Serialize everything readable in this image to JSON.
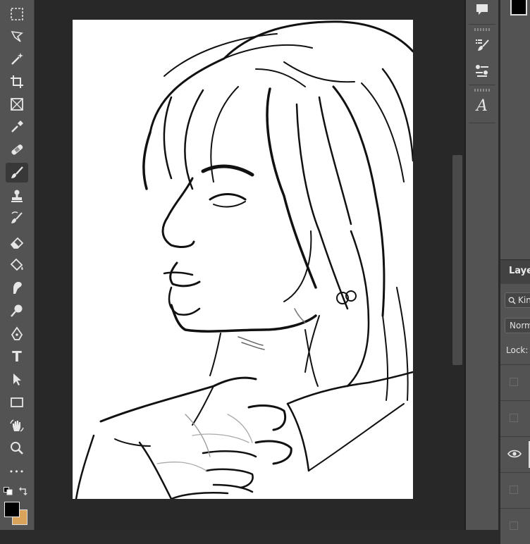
{
  "toolbar": {
    "tools": [
      {
        "name": "rectangular-marquee",
        "icon": "marquee-icon",
        "active": false
      },
      {
        "name": "lasso",
        "icon": "lasso-icon",
        "active": false
      },
      {
        "name": "magic-wand",
        "icon": "magic-wand-icon",
        "active": false
      },
      {
        "name": "crop",
        "icon": "crop-icon",
        "active": false
      },
      {
        "name": "frame",
        "icon": "frame-icon",
        "active": false
      },
      {
        "name": "eyedropper",
        "icon": "eyedropper-icon",
        "active": false
      },
      {
        "name": "healing-brush",
        "icon": "bandage-icon",
        "active": false
      },
      {
        "name": "brush",
        "icon": "brush-icon",
        "active": true
      },
      {
        "name": "clone-stamp",
        "icon": "stamp-icon",
        "active": false
      },
      {
        "name": "history-brush",
        "icon": "history-brush-icon",
        "active": false
      },
      {
        "name": "eraser",
        "icon": "eraser-icon",
        "active": false
      },
      {
        "name": "paint-bucket",
        "icon": "bucket-icon",
        "active": false
      },
      {
        "name": "smudge",
        "icon": "smudge-icon",
        "active": false
      },
      {
        "name": "dodge",
        "icon": "dodge-icon",
        "active": false
      },
      {
        "name": "pen",
        "icon": "pen-icon",
        "active": false
      },
      {
        "name": "type",
        "icon": "type-icon",
        "active": false
      },
      {
        "name": "path-selection",
        "icon": "arrow-icon",
        "active": false
      },
      {
        "name": "rectangle",
        "icon": "rectangle-icon",
        "active": false
      },
      {
        "name": "rotate-view",
        "icon": "hand-rotate-icon",
        "active": false
      },
      {
        "name": "zoom",
        "icon": "zoom-icon",
        "active": false
      },
      {
        "name": "more-tools",
        "icon": "ellipsis-icon",
        "active": false
      }
    ],
    "type_glyph": "T",
    "more_glyph": "•••",
    "foreground_color": "#000000",
    "background_color": "#d9a35c"
  },
  "panel_strip": {
    "italic_a": "A"
  },
  "layers_panel": {
    "tab_label": "Layers",
    "search_placeholder": "Kind",
    "blend_mode": "Normal",
    "lock_label": "Lock:"
  },
  "colors": {
    "ui_bg": "#535353",
    "workspace": "#282828",
    "canvas": "#ffffff",
    "accent_swatch": "#d9a35c"
  }
}
